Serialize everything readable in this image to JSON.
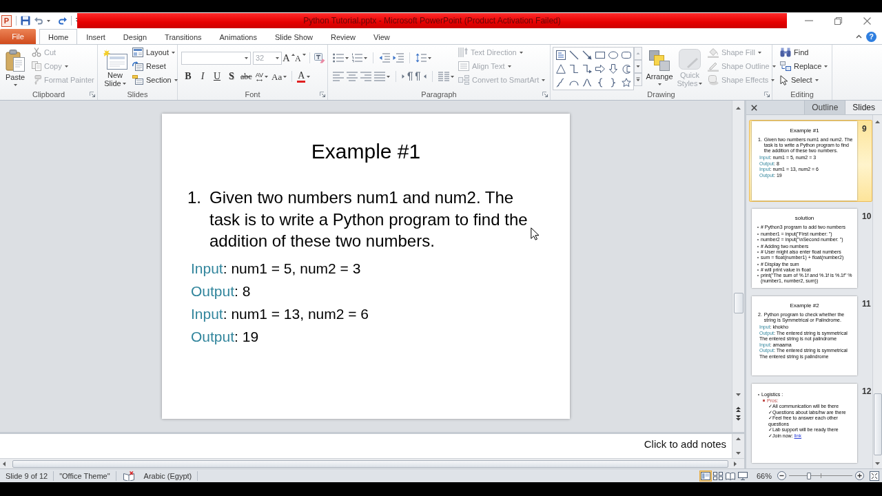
{
  "title_bar": {
    "logo": "P",
    "title": "Python Tutorial.pptx - Microsoft PowerPoint (Product Activation Failed)",
    "help": "?"
  },
  "file_tab": {
    "label": "File"
  },
  "tabs": [
    {
      "label": "Home",
      "selected": true
    },
    {
      "label": "Insert",
      "selected": false
    },
    {
      "label": "Design",
      "selected": false
    },
    {
      "label": "Transitions",
      "selected": false
    },
    {
      "label": "Animations",
      "selected": false
    },
    {
      "label": "Slide Show",
      "selected": false
    },
    {
      "label": "Review",
      "selected": false
    },
    {
      "label": "View",
      "selected": false
    }
  ],
  "clipboard": {
    "label": "Clipboard",
    "paste": "Paste",
    "tools": [
      {
        "kind": "cut",
        "label": "Cut",
        "disabled": true
      },
      {
        "kind": "copy",
        "label": "Copy",
        "disabled": true
      },
      {
        "kind": "painter",
        "label": "Format Painter",
        "disabled": true
      }
    ]
  },
  "slides": {
    "label": "Slides",
    "new_slide": "New Slide",
    "tools": [
      {
        "kind": "layout",
        "label": "Layout"
      },
      {
        "kind": "reset",
        "label": "Reset"
      },
      {
        "kind": "section",
        "label": "Section"
      }
    ]
  },
  "font": {
    "label": "Font",
    "size": {
      "value": "32",
      "disabled": true
    },
    "size_buttons": [
      {
        "kind": "grow",
        "glyph": "A"
      },
      {
        "kind": "shrink",
        "glyph": "A"
      }
    ],
    "format_buttons": [
      {
        "kind": "bold",
        "glyph": "B"
      },
      {
        "kind": "italic",
        "glyph": "I"
      },
      {
        "kind": "underline",
        "glyph": "U"
      },
      {
        "kind": "shadow",
        "glyph": "S"
      },
      {
        "kind": "strikethrough",
        "glyph": "abc"
      },
      {
        "kind": "spacing",
        "glyph": "AV"
      },
      {
        "kind": "case",
        "glyph": "Aa"
      },
      {
        "kind": "color",
        "glyph": "A"
      }
    ]
  },
  "paragraph": {
    "label": "Paragraph",
    "tools": [
      {
        "kind": "direction",
        "label": "Text Direction",
        "disabled": true
      },
      {
        "kind": "align",
        "label": "Align Text",
        "disabled": true
      },
      {
        "kind": "smartart",
        "label": "Convert to SmartArt",
        "disabled": true
      }
    ]
  },
  "drawing": {
    "label": "Drawing",
    "arrange": "Arrange",
    "quick_styles": {
      "label": "Quick Styles",
      "disabled": true
    },
    "tools": [
      {
        "kind": "fill",
        "label": "Shape Fill",
        "disabled": true
      },
      {
        "kind": "outline",
        "label": "Shape Outline",
        "disabled": true
      },
      {
        "kind": "effects",
        "label": "Shape Effects",
        "disabled": true
      }
    ]
  },
  "editing": {
    "label": "Editing",
    "tools": [
      {
        "kind": "find",
        "label": "Find"
      },
      {
        "kind": "replace",
        "label": "Replace"
      },
      {
        "kind": "select",
        "label": "Select"
      }
    ]
  },
  "slide": {
    "title": "Example #1",
    "items": [
      {
        "number": "1.",
        "text": "Given two numbers num1 and num2. The task is to write a Python program to find the addition of these two numbers."
      }
    ],
    "io": [
      {
        "label": "Input",
        "text": ": num1 = 5, num2 = 3"
      },
      {
        "label": "Output",
        "text": ": 8"
      },
      {
        "label": "Input",
        "text": ": num1 = 13, num2 = 6"
      },
      {
        "label": "Output",
        "text": ": 19"
      }
    ]
  },
  "notes": {
    "placeholder": "Click to add notes"
  },
  "panel": {
    "tabs": [
      {
        "label": "Outline",
        "selected": false
      },
      {
        "label": "Slides",
        "selected": true
      }
    ],
    "thumbnails": [
      {
        "number": "9",
        "selected": true,
        "kind": "example",
        "title": "Example #1",
        "items": [
          {
            "number": "1.",
            "text": "Given two numbers num1 and num2. The task is to write a Python program to find the addition of these two numbers."
          }
        ],
        "io": [
          {
            "label": "Input",
            "text": ": num1 = 5, num2 = 3"
          },
          {
            "label": "Output",
            "text": ": 8"
          },
          {
            "label": "Input",
            "text": ": num1 = 13, num2 = 6"
          },
          {
            "label": "Output",
            "text": ": 19"
          }
        ]
      },
      {
        "number": "10",
        "selected": false,
        "kind": "code",
        "title": "solution",
        "groups": [
          [
            "# Python3 program to add two numbers"
          ],
          [
            "number1 = input(\"First number: \")",
            "number2 = input(\"\\nSecond number: \")"
          ],
          [
            "# Adding two numbers",
            "# User might also enter float numbers",
            "sum = float(number1) + float(number2)"
          ],
          [
            "# Display the sum",
            "# will print value in float",
            "print(\"The sum of %.1f and %.1f is %.1f\" %(number1, number2, sum))"
          ]
        ]
      },
      {
        "number": "11",
        "selected": false,
        "kind": "example",
        "title": "Example #2",
        "items": [
          {
            "number": "2.",
            "text": "Python program to check whether the string is Symmetrical or Palindrome."
          }
        ],
        "io": [
          {
            "label": "Input",
            "text": ": khokho"
          },
          {
            "label": "Output",
            "text": ": The entered string is symmetrical The entered string is not palindrome"
          },
          {
            "label": "Input",
            "text": ": amaama"
          },
          {
            "label": "Output",
            "text": ": The entered string is symmetrical The entered string is palindrome"
          }
        ]
      },
      {
        "number": "12",
        "selected": false,
        "kind": "bullets",
        "items": [
          {
            "text": "Logistics :",
            "children": [
              {
                "text": "Pros:",
                "color": "#c0504d",
                "children": [
                  {
                    "text": "✓All communication will be there"
                  },
                  {
                    "text": "✓Questions about labs/hw are there"
                  },
                  {
                    "text": "✓Feel free to answer each other questions"
                  },
                  {
                    "text": "✓Lab support will be ready there"
                  },
                  {
                    "text": "✓Join now: ",
                    "link": "link"
                  }
                ]
              }
            ]
          }
        ]
      }
    ]
  },
  "status_bar": {
    "slide": "Slide 9 of 12",
    "theme": "\"Office Theme\"",
    "language": "Arabic (Egypt)",
    "views": [
      {
        "kind": "normal",
        "selected": true
      },
      {
        "kind": "sorter",
        "selected": false
      },
      {
        "kind": "reading",
        "selected": false
      },
      {
        "kind": "slideshow",
        "selected": false
      }
    ],
    "zoom": {
      "value": "66%",
      "level": 0.32
    }
  }
}
